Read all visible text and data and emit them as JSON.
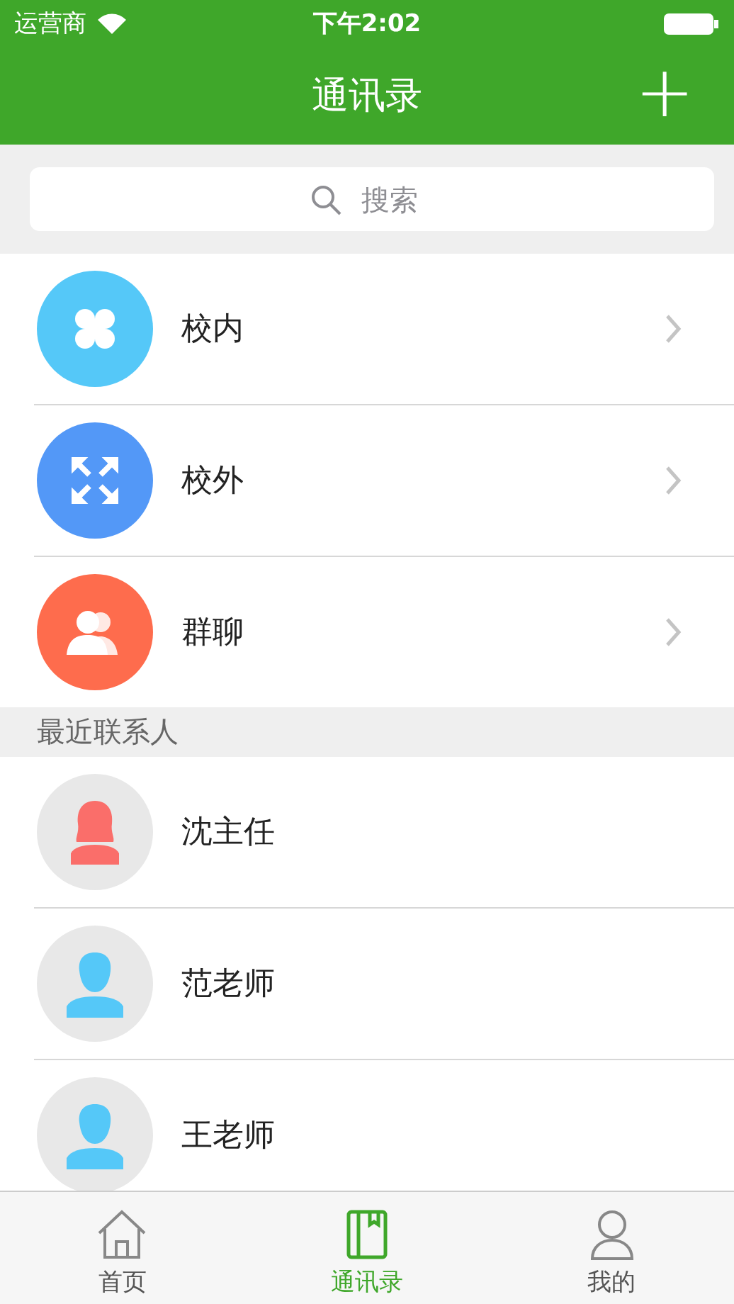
{
  "status_bar": {
    "carrier": "运营商",
    "time": "下午2:02"
  },
  "nav": {
    "title": "通讯录",
    "add_button": "+"
  },
  "search": {
    "placeholder": "搜索"
  },
  "groups": [
    {
      "label": "校内",
      "kind": "clover",
      "color": "#55c8f8"
    },
    {
      "label": "校外",
      "kind": "arrows",
      "color": "#5398f7"
    },
    {
      "label": "群聊",
      "kind": "people",
      "color": "#fe6c4d"
    }
  ],
  "section_title": "最近联系人",
  "contacts": [
    {
      "name": "沈主任",
      "kind": "female"
    },
    {
      "name": "范老师",
      "kind": "male"
    },
    {
      "name": "王老师",
      "kind": "male"
    }
  ],
  "tabs": [
    {
      "label": "首页",
      "kind": "home",
      "selected": false
    },
    {
      "label": "通讯录",
      "kind": "book",
      "selected": true
    },
    {
      "label": "我的",
      "kind": "user",
      "selected": false
    }
  ]
}
